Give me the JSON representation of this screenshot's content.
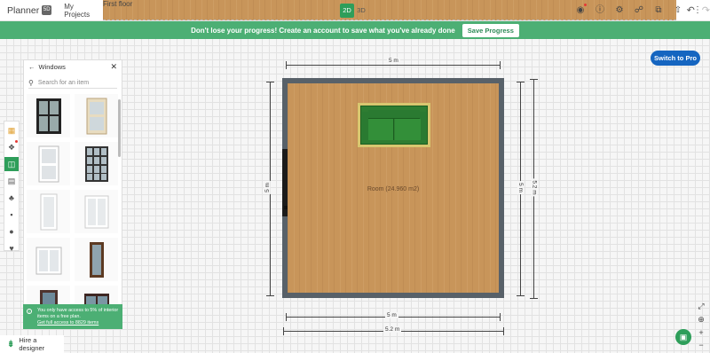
{
  "app": {
    "logo_text": "Planner",
    "logo_badge": "5D"
  },
  "header": {
    "my_projects": "My Projects",
    "floor": "First floor",
    "undo_icon": "↶",
    "redo_icon": "↷",
    "mode_2d": "2D",
    "mode_3d": "3D",
    "toolbar_icons": [
      "camera-icon",
      "info-icon",
      "settings-icon",
      "share-icon",
      "layers-icon",
      "export-icon",
      "more-icon"
    ]
  },
  "banner": {
    "message": "Don't lose your progress! Create an account to save what you've already done",
    "button": "Save Progress"
  },
  "switch_pro": "Switch to Pro",
  "catalog": {
    "title": "Windows",
    "search_placeholder": "Search for an item",
    "items": [
      "window-1",
      "window-2",
      "window-3",
      "window-4",
      "window-5",
      "window-6",
      "window-7",
      "window-8",
      "door-1",
      "door-2"
    ]
  },
  "notice": {
    "text": "You only have access to 5% of interior items on a free plan.",
    "link": "Get full access to 8829 items"
  },
  "hire": "Hire a designer",
  "room": {
    "label": "Room (24.960 m2)"
  },
  "dimensions": {
    "top": "5 m",
    "left": "5 m",
    "right_inner": "5 m",
    "right_outer": "5.2 m",
    "bottom_inner": "5 m",
    "bottom_outer": "5.2 m"
  },
  "colors": {
    "accent": "#2e9e5a",
    "banner": "#4caf74",
    "pro": "#1565c0",
    "wall": "#586169",
    "floor": "#c8955a"
  }
}
